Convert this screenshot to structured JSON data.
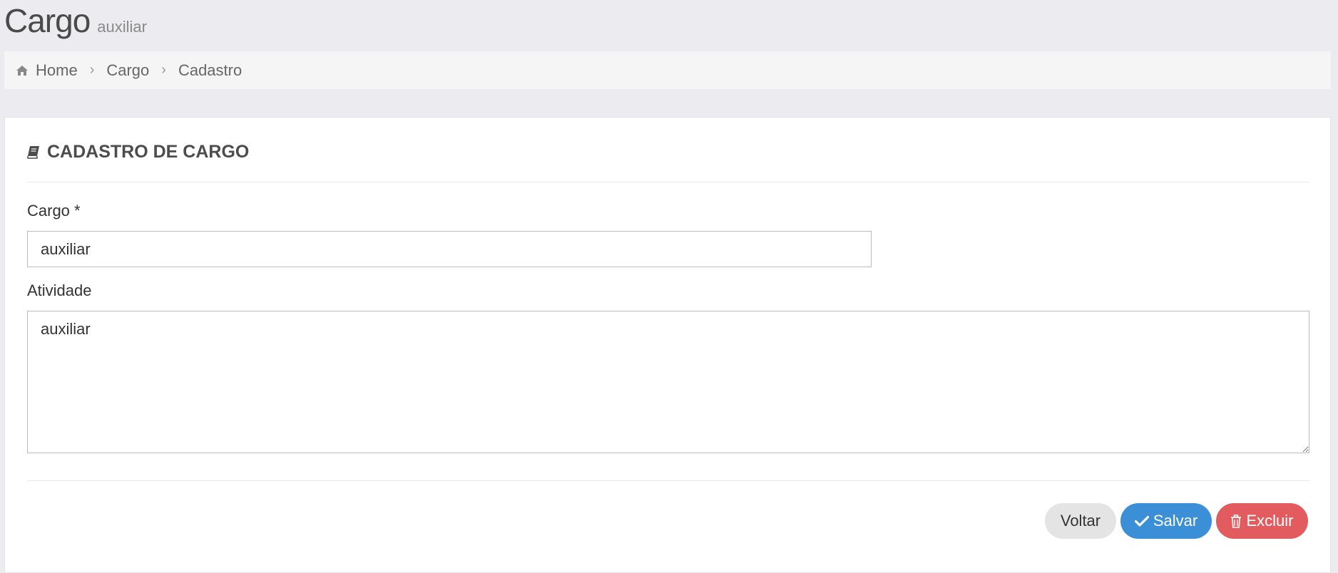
{
  "header": {
    "title": "Cargo",
    "subtitle": "auxiliar"
  },
  "breadcrumb": {
    "items": [
      {
        "label": "Home",
        "icon": "home-icon"
      },
      {
        "label": "Cargo"
      },
      {
        "label": "Cadastro"
      }
    ],
    "separator": "›"
  },
  "card": {
    "title": "CADASTRO DE CARGO",
    "icon": "book-icon"
  },
  "form": {
    "cargo": {
      "label": "Cargo *",
      "value": "auxiliar"
    },
    "atividade": {
      "label": "Atividade",
      "value": "auxiliar"
    }
  },
  "actions": {
    "back_label": "Voltar",
    "save_label": "Salvar",
    "save_icon": "check-icon",
    "delete_label": "Excluir",
    "delete_icon": "trash-icon"
  },
  "colors": {
    "save": "#3a8fd6",
    "delete": "#e25c5f",
    "back": "#e4e4e4"
  }
}
